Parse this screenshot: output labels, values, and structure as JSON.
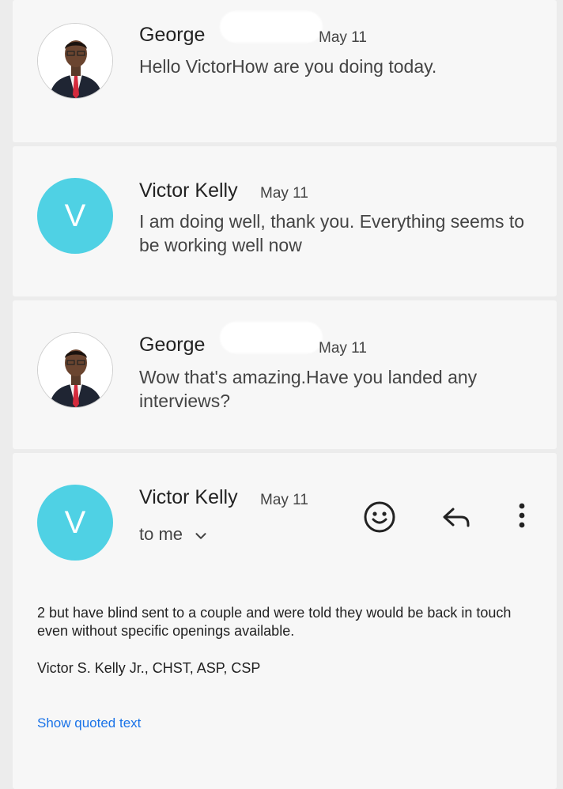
{
  "messages": [
    {
      "sender": "George",
      "date": "May 11",
      "snippet": "Hello VictorHow are you doing today."
    },
    {
      "sender": "Victor Kelly",
      "date": "May 11",
      "avatar_letter": "V",
      "snippet": "I am doing well, thank you. Everything seems to be working well now"
    },
    {
      "sender": "George",
      "date": "May 11",
      "snippet": "Wow that's amazing.Have you landed any interviews?"
    },
    {
      "sender": "Victor Kelly",
      "date": "May 11",
      "avatar_letter": "V",
      "recipient": "to me"
    }
  ],
  "expanded": {
    "body": "2 but have blind sent to a couple and were told they would be back in touch even without specific openings available.",
    "signature": "Victor S. Kelly Jr., CHST, ASP, CSP",
    "show_quoted": "Show quoted text"
  },
  "icons": {
    "emoji": "smiley-icon",
    "reply": "reply-icon",
    "more": "more-vert-icon",
    "expand": "chevron-down-icon"
  },
  "colors": {
    "avatar_bg": "#4fd1e4",
    "link": "#1a73e8"
  }
}
